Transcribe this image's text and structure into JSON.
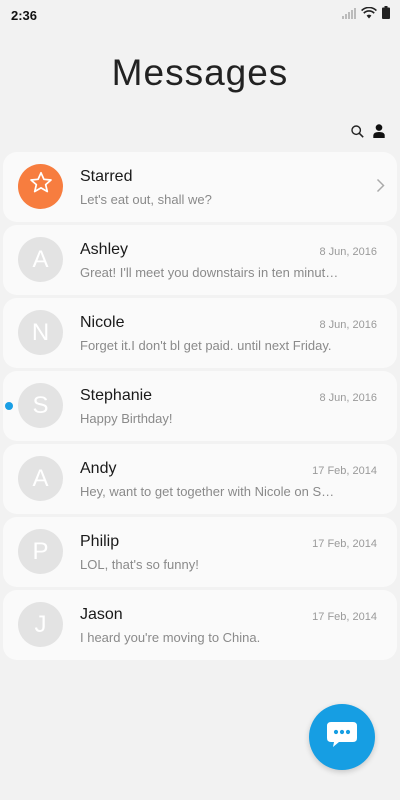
{
  "status_bar": {
    "time": "2:36"
  },
  "header": {
    "title": "Messages"
  },
  "icons": {
    "search": "search-icon",
    "contacts": "person-icon",
    "starred": "star-icon",
    "chevron": "chevron-right-icon",
    "compose": "chat-bubble-icon"
  },
  "conversations": [
    {
      "initial": "",
      "name": "Starred",
      "date": "",
      "preview": "Let's eat out, shall we?"
    },
    {
      "initial": "A",
      "name": "Ashley",
      "date": "8 Jun, 2016",
      "preview": "Great! I'll meet you downstairs in ten minutes."
    },
    {
      "initial": "N",
      "name": "Nicole",
      "date": "8 Jun, 2016",
      "preview": "Forget it.I don't bl get paid. until next Friday."
    },
    {
      "initial": "S",
      "name": "Stephanie",
      "date": "8 Jun, 2016",
      "preview": "Happy Birthday!"
    },
    {
      "initial": "A",
      "name": "Andy",
      "date": "17 Feb, 2014",
      "preview": "Hey, want to get together with Nicole on Saturday?"
    },
    {
      "initial": "P",
      "name": "Philip",
      "date": "17 Feb, 2014",
      "preview": "LOL, that's so funny!"
    },
    {
      "initial": "J",
      "name": "Jason",
      "date": "17 Feb, 2014",
      "preview": "I heard you're moving to China."
    }
  ],
  "colors": {
    "background": "#f2f2f2",
    "card": "#fafafa",
    "avatar": "#e3e3e3",
    "starred_avatar": "#f77d3f",
    "accent": "#169ee3",
    "unread_dot": "#1a9fe5"
  }
}
